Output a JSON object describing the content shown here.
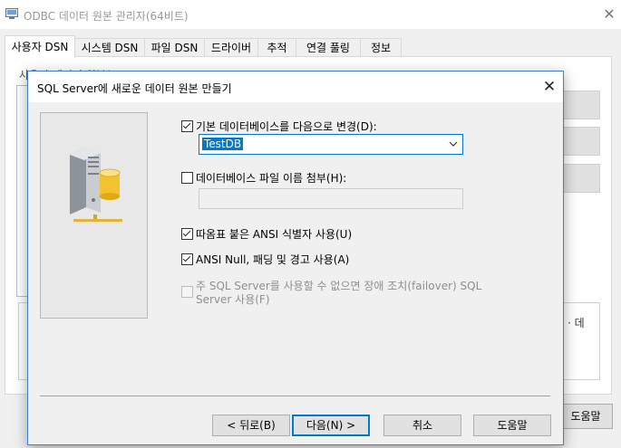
{
  "background_window": {
    "title": "ODBC 데이터 원본 관리자(64비트)",
    "tabs": [
      "사용자 DSN",
      "시스템 DSN",
      "파일 DSN",
      "드라이버",
      "추적",
      "연결 풀링",
      "정보"
    ],
    "active_tab_index": 0,
    "group_label_fragment": "사용자 데이터 원본(",
    "description_fragment": "· 데",
    "help_button": "도움말"
  },
  "dialog": {
    "title": "SQL Server에 새로운 데이터 원본 만들기",
    "options": {
      "change_default_db": {
        "label": "기본 데이터베이스를 다음으로 변경(D):",
        "checked": true
      },
      "default_db_value": "TestDB",
      "attach_db_file": {
        "label": "데이터베이스 파일 이름 첨부(H):",
        "checked": false,
        "value": ""
      },
      "quoted_identifiers": {
        "label": "따옴표 붙은 ANSI 식별자 사용(U)",
        "checked": true
      },
      "ansi_nulls": {
        "label": "ANSI Null, 패딩 및 경고 사용(A)",
        "checked": true
      },
      "failover": {
        "label_line1": "주 SQL Server를 사용할 수 없으면 장애 조치(failover) SQL",
        "label_line2": "Server 사용(F)",
        "checked": false,
        "enabled": false
      }
    },
    "buttons": {
      "back": "< 뒤로(B)",
      "next": "다음(N) >",
      "cancel": "취소",
      "help": "도움말"
    }
  },
  "icons": {
    "app": "odbc-app-icon",
    "server": "database-server-icon",
    "close": "close-icon",
    "dropdown": "chevron-down-icon"
  },
  "colors": {
    "accent": "#0078d7",
    "dialog_border": "#3d7ed8"
  }
}
